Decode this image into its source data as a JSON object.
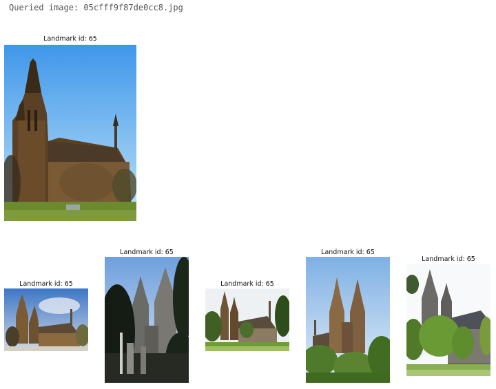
{
  "query": {
    "text": "Queried image: 05cfff9f87de0cc8.jpg"
  },
  "results": [
    {
      "caption": "Landmark id: 65"
    },
    {
      "caption": "Landmark id: 65"
    },
    {
      "caption": "Landmark id: 65"
    },
    {
      "caption": "Landmark id: 65"
    },
    {
      "caption": "Landmark id: 65"
    },
    {
      "caption": "Landmark id: 65"
    }
  ]
}
